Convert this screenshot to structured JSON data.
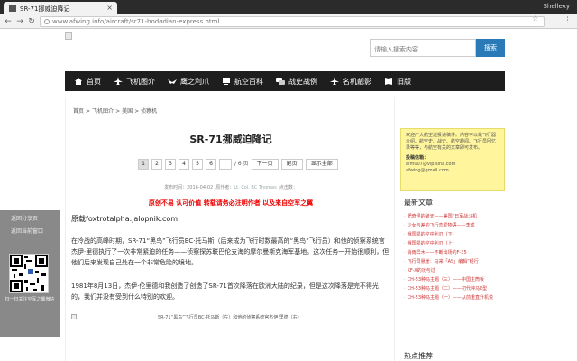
{
  "browser": {
    "tab_title": "SR-71挪威迫降记",
    "tab_close": "×",
    "profile": "Shellexy",
    "url": "www.afwing.info/aircraft/sr71-bodødian-express.html"
  },
  "search": {
    "placeholder": "请输入搜索内容",
    "button": "搜索"
  },
  "nav": {
    "items": [
      {
        "label": "首页",
        "icon": "home-icon"
      },
      {
        "label": "飞机图介",
        "icon": "plane-icon"
      },
      {
        "label": "鹰之利爪",
        "icon": "eagle-icon"
      },
      {
        "label": "航空百科",
        "icon": "computer-icon"
      },
      {
        "label": "战史战例",
        "icon": "chat-icon"
      },
      {
        "label": "名机靓影",
        "icon": "plane-icon"
      },
      {
        "label": "旧版",
        "icon": "book-icon"
      }
    ]
  },
  "breadcrumb": {
    "items": [
      "首页",
      "飞机图介",
      "美国",
      "侦察机"
    ],
    "sep": ">"
  },
  "article": {
    "title": "SR-71挪威迫降记",
    "pages": [
      "1",
      "2",
      "3",
      "4",
      "5",
      "6"
    ],
    "total": "/ 6 页",
    "next": "下一页",
    "last": "尾页",
    "show_all": "显示全部",
    "meta_prefix": "发布时间：",
    "date": "2016-04-02",
    "author_label": "原作者：",
    "author": "Lt. Col. BC Thomas",
    "clicks_label": "点击数：",
    "notice": "原创不易 认可价值 转载请务必注明作者 以及来自空军之翼",
    "source_label": "原载",
    "source": "foxtrotalpha.jalopnik.com",
    "p1": "在冷战的高峰时期，SR-71“黑鸟”飞行员BC·托马斯（后来成为飞行时数最高的“黑鸟”飞行员）和他的侦察系统官杰伊·里德执行了一次非常紧迫的任务——侦察探苏联巴伦支海的摩尔曼斯克海军基地。这次任务一开始很顺利，但他们后来发现自己处在一个非常危险的境地。",
    "p2": "1981年8月13日，杰伊·伦里德和我创造了创造了SR-71首次降落在欧洲大陆的纪录，但是这次降落是完不得光的，我们并没有受到什么特别的欢迎。",
    "caption": "SR-71“黑鸟”飞行员BC·托马斯（左）和他的侦察系统官杰伊·里德（右）"
  },
  "sidebar": {
    "notice": "欢迎广大航空迷投递稿件。内容可以是飞行器介绍、航空史、战史、航空趣闻、飞行员回忆录等等，与航空有关的文章即可发布。",
    "contact_title": "投稿信箱：",
    "email1": "aim007@vip.sina.com",
    "email2": "afwing@gmail.com",
    "latest_title": "最新文章",
    "latest": [
      "肥奇怪的破天——美国“日军战斗机",
      "少女与差的飞行恋爱物语——李成",
      "俄国陨的空中利刃（下）",
      "俄国陨的空中利刃（上）",
      "消雨异木——不断出场的F-35",
      "飞行员悬崖：马来「AS」编辑”经行",
      "KF-X的功与过",
      "CH-53种马主题（三）——中国主筒板",
      "CH-53种马主题（二）——初代种马E型",
      "CH-53种马主题（一）——从前重直升机说"
    ],
    "hot_title": "热点推荐"
  },
  "float": {
    "link1": "返回分享页",
    "link2": "返回当前窗口",
    "note": "扫一扫关注空军之翼微信"
  }
}
